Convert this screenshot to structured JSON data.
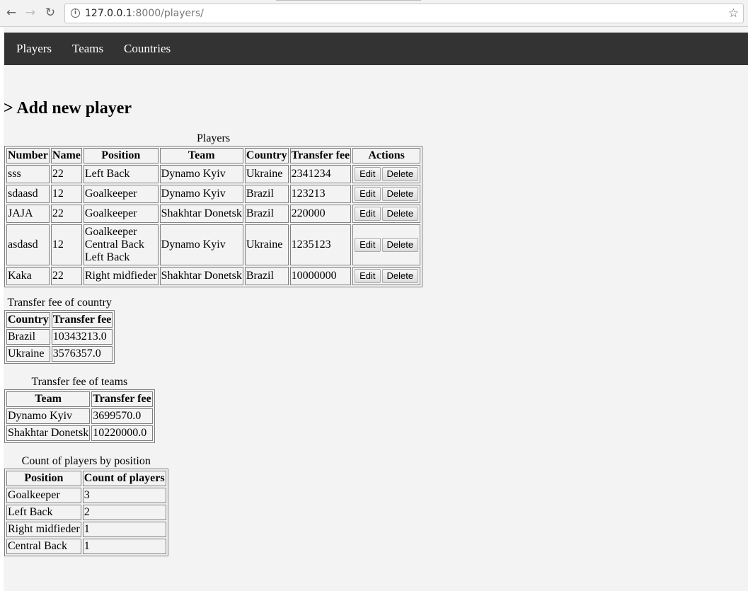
{
  "browser": {
    "url_host": "127.0.0.1",
    "url_rest": ":8000/players/"
  },
  "nav": {
    "items": [
      "Players",
      "Teams",
      "Countries"
    ]
  },
  "heading": "> Add new player",
  "players_table": {
    "caption": "Players",
    "headers": [
      "Number",
      "Name",
      "Position",
      "Team",
      "Country",
      "Transfer fee",
      "Actions"
    ],
    "rows": [
      {
        "number": "sss",
        "name": "22",
        "position": [
          "Left Back"
        ],
        "team": "Dynamo Kyiv",
        "country": "Ukraine",
        "fee": "2341234"
      },
      {
        "number": "sdaasd",
        "name": "12",
        "position": [
          "Goalkeeper"
        ],
        "team": "Dynamo Kyiv",
        "country": "Brazil",
        "fee": "123213"
      },
      {
        "number": "JAJA",
        "name": "22",
        "position": [
          "Goalkeeper"
        ],
        "team": "Shakhtar Donetsk",
        "country": "Brazil",
        "fee": "220000"
      },
      {
        "number": "asdasd",
        "name": "12",
        "position": [
          "Goalkeeper",
          "Central Back",
          "Left Back"
        ],
        "team": "Dynamo Kyiv",
        "country": "Ukraine",
        "fee": "1235123"
      },
      {
        "number": "Kaka",
        "name": "22",
        "position": [
          "Right midfieder"
        ],
        "team": "Shakhtar Donetsk",
        "country": "Brazil",
        "fee": "10000000"
      }
    ],
    "edit_label": "Edit",
    "delete_label": "Delete"
  },
  "country_table": {
    "caption": "Transfer fee of country",
    "headers": [
      "Country",
      "Transfer fee"
    ],
    "rows": [
      [
        "Brazil",
        "10343213.0"
      ],
      [
        "Ukraine",
        "3576357.0"
      ]
    ]
  },
  "teams_table": {
    "caption": "Transfer fee of teams",
    "headers": [
      "Team",
      "Transfer fee"
    ],
    "rows": [
      [
        "Dynamo Kyiv",
        "3699570.0"
      ],
      [
        "Shakhtar Donetsk",
        "10220000.0"
      ]
    ]
  },
  "position_table": {
    "caption": "Count of players by position",
    "headers": [
      "Position",
      "Count of players"
    ],
    "rows": [
      [
        "Goalkeeper",
        "3"
      ],
      [
        "Left Back",
        "2"
      ],
      [
        "Right midfieder",
        "1"
      ],
      [
        "Central Back",
        "1"
      ]
    ]
  }
}
